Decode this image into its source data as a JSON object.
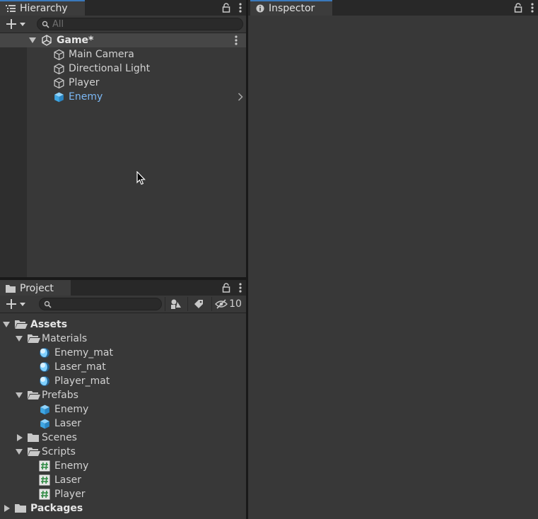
{
  "hierarchy": {
    "tab_label": "Hierarchy",
    "search_placeholder": "All",
    "scene_name": "Game*",
    "items": [
      {
        "label": "Main Camera",
        "icon": "gameobject-icon",
        "selected": false
      },
      {
        "label": "Directional Light",
        "icon": "gameobject-icon",
        "selected": false
      },
      {
        "label": "Player",
        "icon": "gameobject-icon",
        "selected": false
      },
      {
        "label": "Enemy",
        "icon": "prefab-icon",
        "selected": true
      }
    ]
  },
  "inspector": {
    "tab_label": "Inspector"
  },
  "project": {
    "tab_label": "Project",
    "search_value": "",
    "hidden_count": "10",
    "tree": [
      {
        "label": "Assets",
        "bold": true
      },
      {
        "label": "Materials"
      },
      {
        "label": "Enemy_mat"
      },
      {
        "label": "Laser_mat"
      },
      {
        "label": "Player_mat"
      },
      {
        "label": "Prefabs"
      },
      {
        "label": "Enemy"
      },
      {
        "label": "Laser"
      },
      {
        "label": "Scenes"
      },
      {
        "label": "Scripts"
      },
      {
        "label": "Enemy"
      },
      {
        "label": "Laser"
      },
      {
        "label": "Player"
      },
      {
        "label": "Packages",
        "bold": true
      }
    ]
  },
  "colors": {
    "panel_bg": "#383838",
    "tab_bg": "#282828",
    "selected_text": "#7cb8f5",
    "prefab_blue": "#55b4ee",
    "accent_tab": "#3a79bb"
  }
}
